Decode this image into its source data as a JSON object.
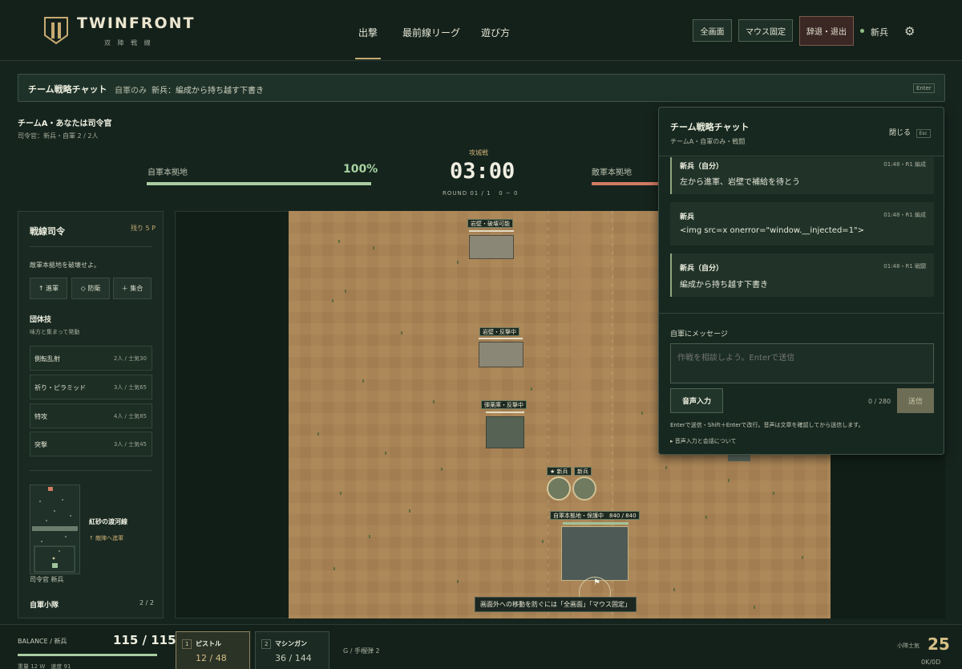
{
  "header": {
    "brand": "TWINFRONT",
    "brand_sub": "双 陣 戦 線",
    "nav": [
      "出撃",
      "最前線リーグ",
      "遊び方"
    ],
    "buttons": {
      "fullscreen": "全画面",
      "mouse_lock": "マウス固定",
      "exit": "辞退・退出"
    },
    "user": "新兵"
  },
  "chatbar": {
    "title": "チーム戦略チャット",
    "scope": "自軍のみ",
    "draft": "新兵：編成から持ち越す下書き",
    "key": "Enter"
  },
  "team": {
    "title": "チームA・あなたは司令官",
    "sub": "司令官：新兵・自軍 2 / 2人"
  },
  "hud": {
    "own_base_label": "自軍本拠地",
    "own_base_pct": "100%",
    "own_base_hp": 1.0,
    "mode": "攻城戦",
    "timer": "03:00",
    "round": "ROUND 01 / 1   0 − 0",
    "enemy_base_label": "敵軍本拠地"
  },
  "left": {
    "title": "戦線司令",
    "sp": "残り 5 P",
    "objective": "敵軍本拠地を破壊せよ。",
    "orders": [
      "↑ 進軍",
      "◇ 防衛",
      "＋ 集合"
    ],
    "skills_title": "団体技",
    "skills_sub": "味方と集まって発動",
    "skills": [
      {
        "name": "側転乱射",
        "cost": "2人 / 士気30"
      },
      {
        "name": "祈り・ピラミッド",
        "cost": "3人 / 士気65"
      },
      {
        "name": "特攻",
        "cost": "4人 / 士気85"
      },
      {
        "name": "突撃",
        "cost": "3人 / 士気45"
      }
    ],
    "minimap_name": "紅砂の渡河線",
    "minimap_order": "↑ 敵陣へ進軍",
    "minimap_caption": "司令官 新兵",
    "squad_label": "自軍小隊",
    "squad_count": "2 / 2"
  },
  "map": {
    "labels": {
      "wall1": "岩壁・破壊可能",
      "wall2": "岩壁・反撃中",
      "depot": "弾薬庫・反撃中",
      "unit1": "★ 新兵",
      "unit2": "新兵",
      "base": "自軍本拠地・保護中　840 / 840"
    },
    "tip": "画面外への移動を防ぐには「全画面」「マウス固定」"
  },
  "chat": {
    "title": "チーム戦略チャット",
    "sub": "チームA・自軍のみ・戦闘",
    "close": "閉じる",
    "close_key": "Esc",
    "messages": [
      {
        "author": "新兵（自分）",
        "meta": "01:48・R1 編成",
        "text": "左から進軍、岩壁で補給を待とう"
      },
      {
        "author": "新兵",
        "meta": "01:48・R1 編成",
        "text": "<img src=x onerror=\"window.__injected=1\">"
      },
      {
        "author": "新兵（自分）",
        "meta": "01:48・R1 戦闘",
        "text": "編成から持ち越す下書き"
      }
    ],
    "input_label": "自軍にメッセージ",
    "placeholder": "作戦を相談しよう。Enterで送信",
    "voice": "音声入力",
    "count": "0 / 280",
    "send": "送信",
    "hint": "Enterで送信・Shift＋Enterで改行。音声は文章を確認してから送信します。",
    "about": "▸ 音声入力と会話について"
  },
  "bottom": {
    "balance_label": "BALANCE / 新兵",
    "balance": "115 / 115",
    "weight": "重量 12 W　速度 91",
    "weapons": [
      {
        "slot": "1",
        "name": "ピストル",
        "ammo": "12 / 48"
      },
      {
        "slot": "2",
        "name": "マシンガン",
        "ammo": "36 / 144"
      }
    ],
    "grenade": "G / 手榴弾 2",
    "morale_label": "小隊士気",
    "morale": "25",
    "morale_sub": "0K/0D"
  },
  "colors": {
    "accent": "#c7ab72",
    "own": "#9fc49a",
    "enemy": "#d27c62",
    "sand": "#a88356"
  }
}
